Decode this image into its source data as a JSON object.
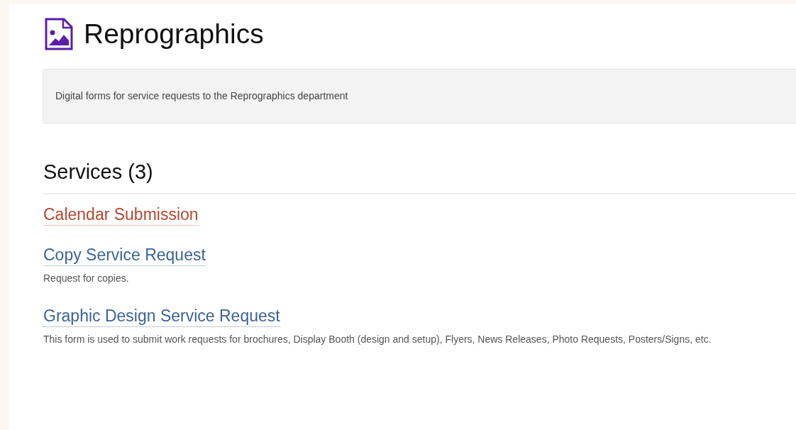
{
  "page": {
    "title": "Reprographics",
    "description": "Digital forms for service requests to the Reprographics department"
  },
  "services": {
    "heading": "Services (3)",
    "items": [
      {
        "title": "Calendar Submission",
        "visited": true
      },
      {
        "title": "Copy Service Request",
        "visited": false,
        "description": "Request for copies."
      },
      {
        "title": "Graphic Design Service Request",
        "visited": false,
        "description": "This form is used to submit work requests for brochures, Display Booth (design and setup), Flyers, News Releases, Photo Requests, Posters/Signs, etc."
      }
    ]
  }
}
